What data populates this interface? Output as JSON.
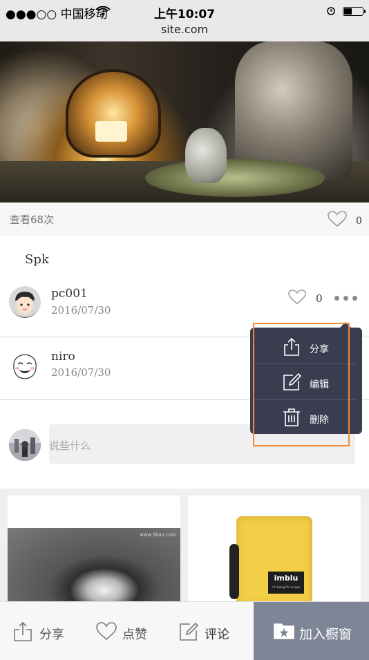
{
  "status_bar": {
    "carrier": "●●●○○ 中国移动",
    "time": "上午10:07",
    "url": "site.com"
  },
  "post": {
    "views": "查看68次",
    "likes": "0",
    "caption": "Spk"
  },
  "comments": [
    {
      "name": "pc001",
      "date": "2016/07/30",
      "likes": "0"
    },
    {
      "name": "niro",
      "date": "2016/07/30"
    }
  ],
  "comment_input": {
    "placeholder": "说些什么"
  },
  "popup_menu": {
    "items": [
      {
        "label": "分享",
        "icon": "share-icon"
      },
      {
        "label": "编辑",
        "icon": "edit-icon"
      },
      {
        "label": "删除",
        "icon": "trash-icon"
      }
    ]
  },
  "recommendations": {
    "card1_watermark": "www.3lian.com",
    "card2_brand": "imblu",
    "card2_tagline": "I'm being life unique"
  },
  "bottom_bar": {
    "share": "分享",
    "like": "点赞",
    "comment": "评论",
    "add": "加入橱窗"
  },
  "colors": {
    "popup_bg": "#3a3c4f",
    "highlight": "#f0893a",
    "add_button_bg": "#7d8597"
  }
}
